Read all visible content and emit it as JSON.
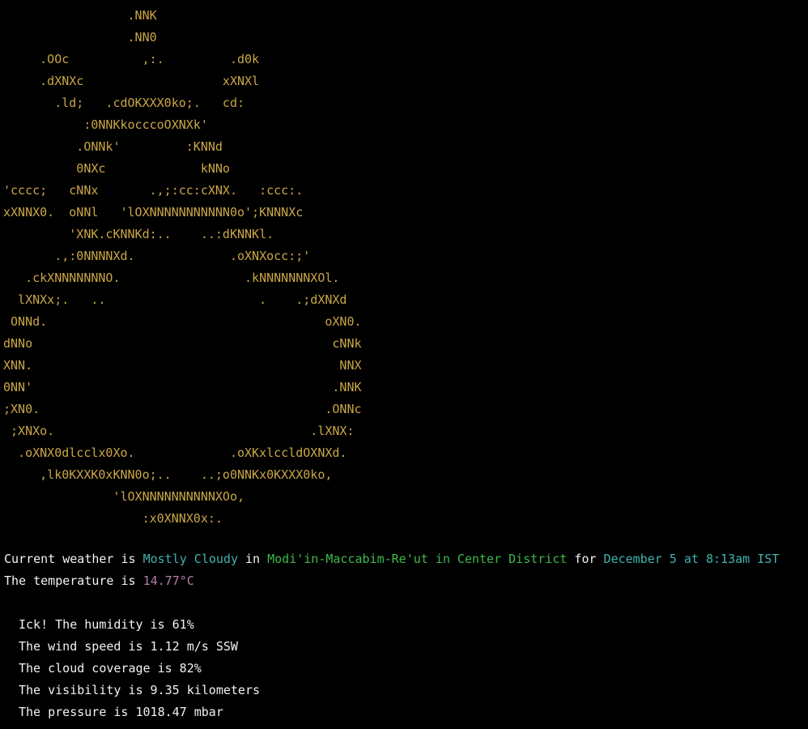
{
  "colors": {
    "background": "#000000",
    "text": "#f2f2f2",
    "ascii_art": "#c9a646",
    "condition": "#3fb3b0",
    "location": "#3dba4c",
    "date": "#3fb3b0",
    "temperature": "#b77ea9"
  },
  "ascii_art_lines": [
    "                 .NNK",
    "                 .NN0",
    "     .OOc          ,:.         .d0k",
    "     .dXNXc                   xXNXl",
    "       .ld;   .cdOKXXX0ko;.   cd:",
    "           :0NNKkocccoOXNXk'",
    "          .ONNk'         :KNNd",
    "          0NXc             kNNo",
    "'cccc;   cNNx       .,;:cc:cXNX.   :ccc:.",
    "xXNNX0.  oNNl   'lOXNNNNNNNNNNN0o';KNNNXc",
    "         'XNK.cKNNKd:..    ..:dKNNKl.",
    "       .,:0NNNNXd.             .oXNXocc:;'",
    "   .ckXNNNNNNNO.                 .kNNNNNNNXOl.",
    "  lXNXx;.   ..                     .    .;dXNXd",
    " ONNd.                                      oXN0.",
    "dNNo                                         cNNk",
    "XNN.                                          NNX",
    "0NN'                                         .NNK",
    ";XN0.                                       .ONNc",
    " ;XNXo.                                   .lXNX:",
    "  .oXNX0dlcclx0Xo.             .oXKxlccldOXNXd.",
    "     ,lk0KXXK0xKNN0o;..    ..;o0NNKx0KXXX0ko,",
    "               'lOXNNNNNNNNNNXOo,",
    "                   :x0XNNX0x:."
  ],
  "report": {
    "current_prefix": "Current weather is ",
    "condition": "Mostly Cloudy",
    "in_word": " in ",
    "location": "Modi'in-Maccabim-Re'ut in Center District",
    "for_word": " for ",
    "datetime": "December 5 at 8:13am IST",
    "temp_prefix": "The temperature is ",
    "temperature": "14.77°C",
    "details": [
      "Ick! The humidity is 61%",
      "The wind speed is 1.12 m/s SSW",
      "The cloud coverage is 82%",
      "The visibility is 9.35 kilometers",
      "The pressure is 1018.47 mbar"
    ]
  }
}
